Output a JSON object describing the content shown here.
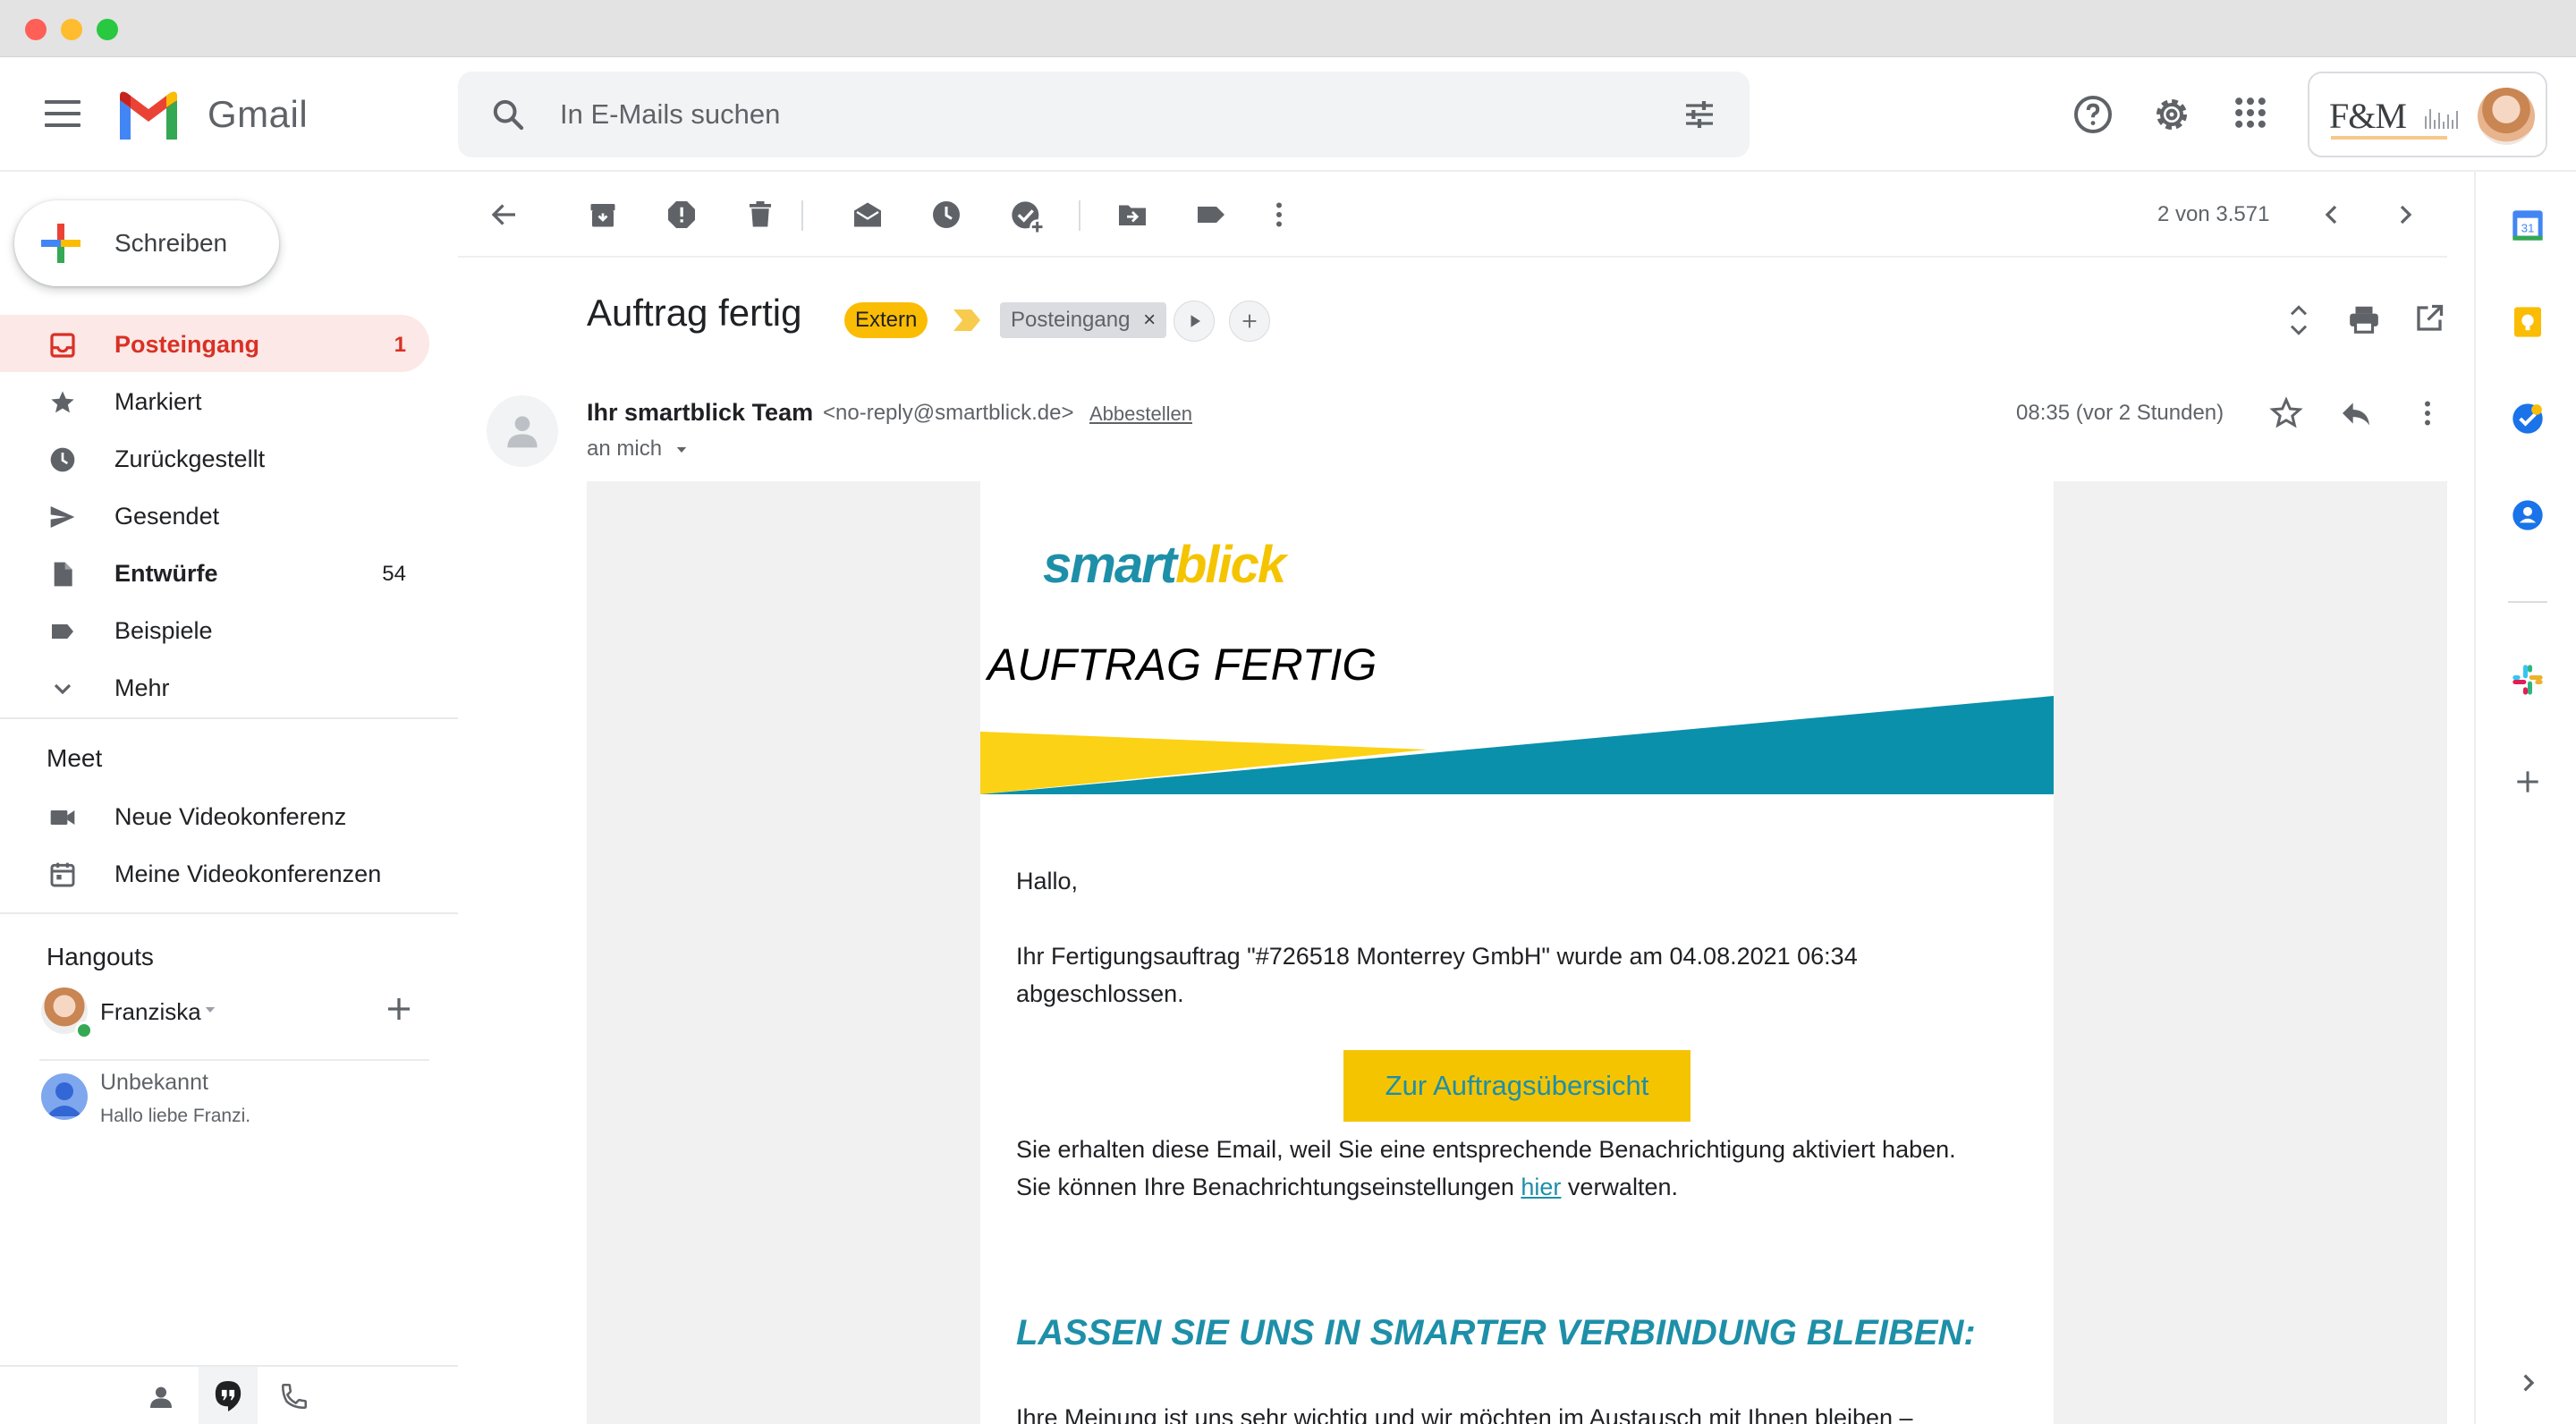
{
  "header": {
    "app_name": "Gmail",
    "search_placeholder": "In E-Mails suchen",
    "account_logo_text": "F&M"
  },
  "sidebar": {
    "compose_label": "Schreiben",
    "items": [
      {
        "label": "Posteingang",
        "count": "1",
        "icon": "inbox-icon"
      },
      {
        "label": "Markiert",
        "count": "",
        "icon": "star-icon"
      },
      {
        "label": "Zurückgestellt",
        "count": "",
        "icon": "clock-icon"
      },
      {
        "label": "Gesendet",
        "count": "",
        "icon": "send-icon"
      },
      {
        "label": "Entwürfe",
        "count": "54",
        "icon": "draft-icon"
      },
      {
        "label": "Beispiele",
        "count": "",
        "icon": "label-icon"
      },
      {
        "label": "Mehr",
        "count": "",
        "icon": "chevron-down-icon"
      }
    ],
    "meet": {
      "title": "Meet",
      "new_meeting": "Neue Videokonferenz",
      "my_meetings": "Meine Videokonferenzen"
    },
    "hangouts": {
      "title": "Hangouts",
      "user": "Franziska",
      "contact_name": "Unbekannt",
      "contact_message": "Hallo liebe Franzi."
    }
  },
  "toolbar": {
    "pager": "2 von 3.571"
  },
  "message": {
    "subject": "Auftrag fertig",
    "label_extern": "Extern",
    "label_inbox": "Posteingang",
    "sender_name": "Ihr smartblick Team",
    "sender_email": "<no-reply@smartblick.de>",
    "unsubscribe": "Abbestellen",
    "recipient": "an mich",
    "time": "08:35 (vor 2 Stunden)"
  },
  "email": {
    "logo_part1": "smart",
    "logo_part2": "blick",
    "title": "AUFTRAG FERTIG",
    "greeting": "Hallo,",
    "line1": "Ihr Fertigungsauftrag \"#726518 Monterrey GmbH\" wurde am 04.08.2021 06:34",
    "line2": "abgeschlossen.",
    "cta": "Zur Auftragsübersicht",
    "notice1": "Sie erhalten diese Email, weil Sie eine entsprechende Benachrichtigung aktiviert haben.",
    "notice2_pre": "Sie können Ihre Benachrichtungseinstellungen ",
    "notice2_link": "hier",
    "notice2_post": " verwalten.",
    "promo_title": "LASSEN SIE UNS IN SMARTER VERBINDUNG BLEIBEN:",
    "promo_text": "Ihre Meinung ist uns sehr wichtig und wir möchten im Austausch mit Ihnen bleiben –"
  },
  "colors": {
    "brand_teal": "#1e8fa8",
    "brand_yellow": "#f5c400",
    "gmail_red": "#d93025",
    "label_yellow": "#fbbc04"
  }
}
